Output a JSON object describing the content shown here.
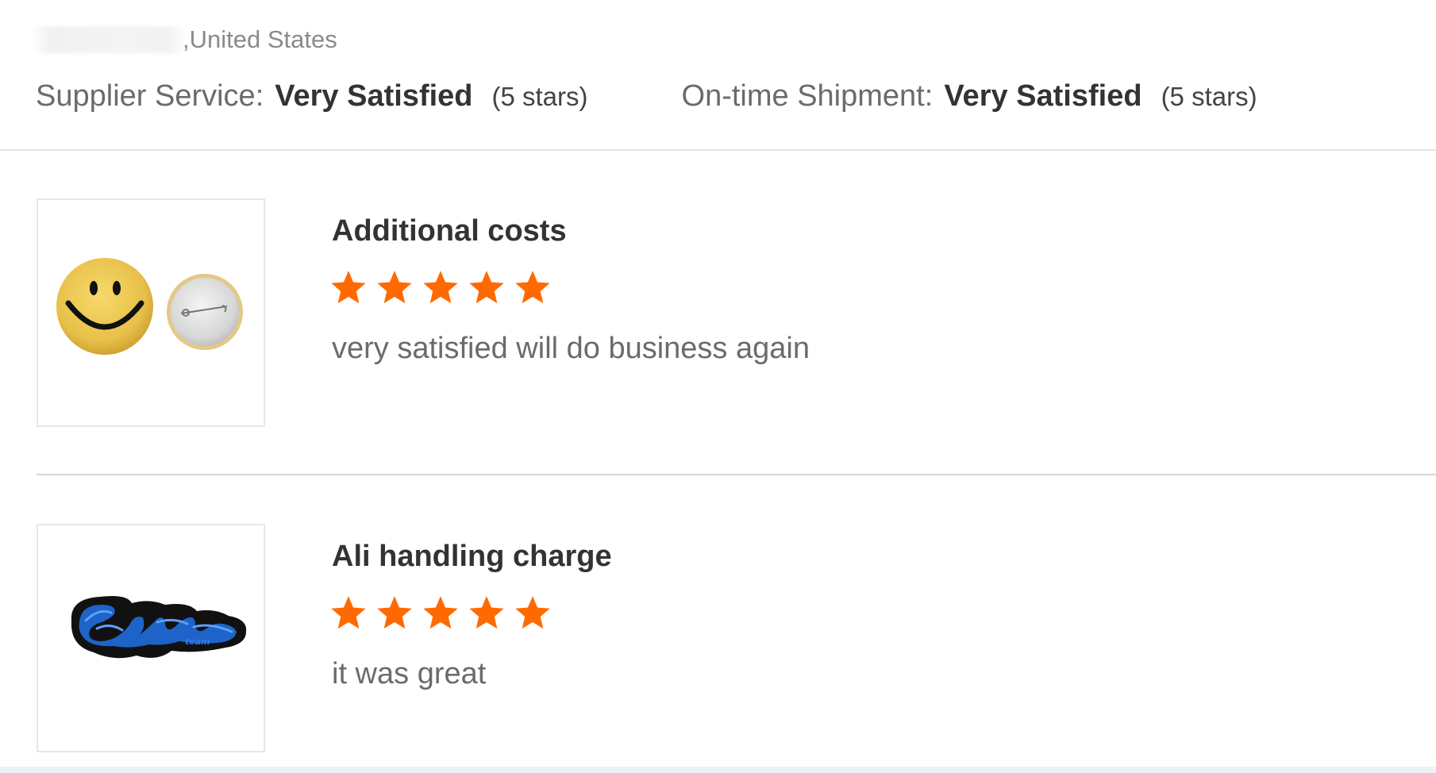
{
  "reviewer": {
    "location": ",United States"
  },
  "ratings": {
    "supplier_service": {
      "label": "Supplier Service:",
      "value": "Very Satisfied",
      "stars_note": "(5 stars)",
      "stars": 5
    },
    "on_time_shipment": {
      "label": "On-time Shipment:",
      "value": "Very Satisfied",
      "stars_note": "(5 stars)",
      "stars": 5
    }
  },
  "reviews": [
    {
      "title": "Additional costs",
      "rating": 5,
      "max_rating": 5,
      "comment": "very satisfied will do business again",
      "thumbnail_icon": "smiley-button-pin-image"
    },
    {
      "title": "Ali handling charge",
      "rating": 5,
      "max_rating": 5,
      "comment": "it was great",
      "thumbnail_icon": "blue-script-pin-image"
    }
  ],
  "colors": {
    "star": "#ff6a00",
    "title_text": "#333333",
    "body_text": "#6b6b6b",
    "divider": "#d6d6d6"
  }
}
